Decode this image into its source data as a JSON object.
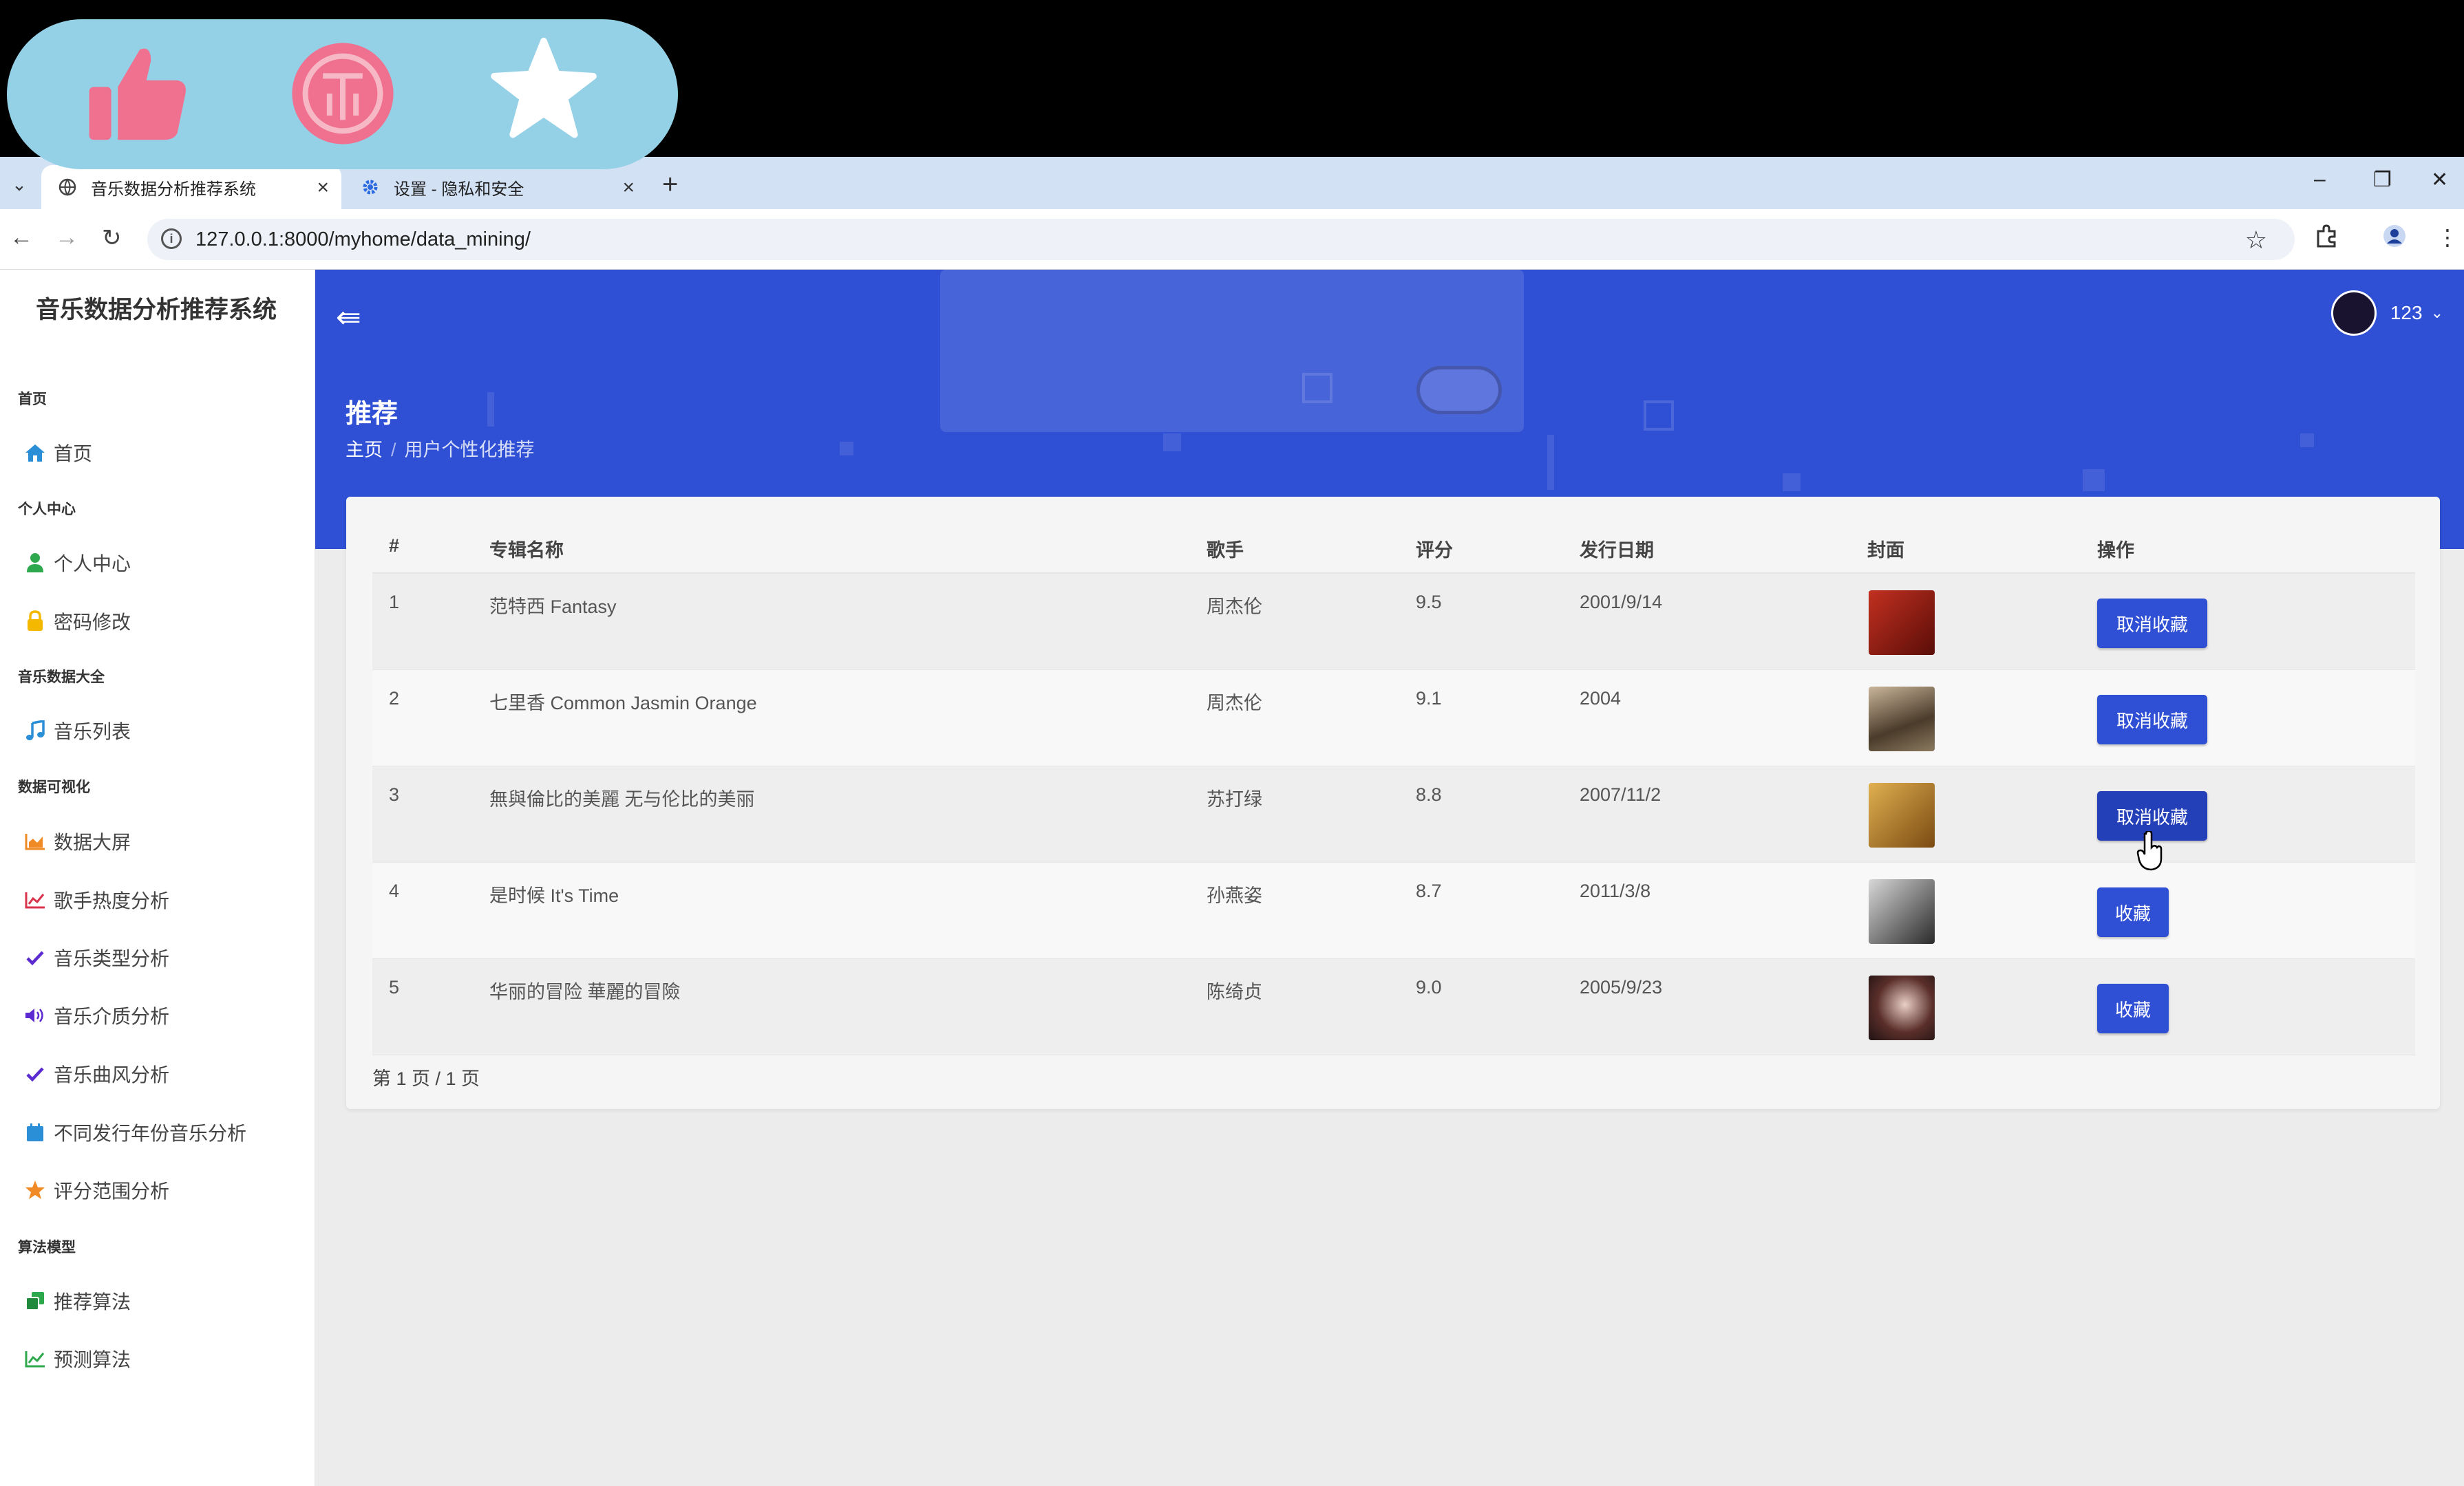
{
  "browser": {
    "tabs": [
      {
        "title": "音乐数据分析推荐系统",
        "close": "×"
      },
      {
        "title": "设置 - 隐私和安全",
        "close": "×"
      }
    ],
    "new_tab": "+",
    "window": {
      "minimize": "–",
      "restore": "❐",
      "close": "✕"
    },
    "url": "127.0.0.1:8000/myhome/data_mining/"
  },
  "sidebar": {
    "brand": "音乐数据分析推荐系统",
    "sections": [
      {
        "label": "首页",
        "items": [
          {
            "label": "首页",
            "icon": "home-icon"
          }
        ]
      },
      {
        "label": "个人中心",
        "items": [
          {
            "label": "个人中心",
            "icon": "user-icon"
          },
          {
            "label": "密码修改",
            "icon": "lock-icon"
          }
        ]
      },
      {
        "label": "音乐数据大全",
        "items": [
          {
            "label": "音乐列表",
            "icon": "music-icon"
          }
        ]
      },
      {
        "label": "数据可视化",
        "items": [
          {
            "label": "数据大屏",
            "icon": "area-chart-icon"
          },
          {
            "label": "歌手热度分析",
            "icon": "line-chart-icon"
          },
          {
            "label": "音乐类型分析",
            "icon": "check-icon"
          },
          {
            "label": "音乐介质分析",
            "icon": "volume-icon"
          },
          {
            "label": "音乐曲风分析",
            "icon": "check-icon"
          },
          {
            "label": "不同发行年份音乐分析",
            "icon": "calendar-icon"
          },
          {
            "label": "评分范围分析",
            "icon": "star-icon"
          }
        ]
      },
      {
        "label": "算法模型",
        "items": [
          {
            "label": "推荐算法",
            "icon": "clone-icon"
          },
          {
            "label": "预测算法",
            "icon": "line-chart-icon"
          }
        ]
      }
    ]
  },
  "header": {
    "user_name": "123",
    "title": "推荐",
    "breadcrumb": {
      "home": "主页",
      "sep": "/",
      "current": "用户个性化推荐"
    }
  },
  "table": {
    "headers": {
      "index": "#",
      "album": "专辑名称",
      "singer": "歌手",
      "score": "评分",
      "date": "发行日期",
      "cover": "封面",
      "action": "操作"
    },
    "rows": [
      {
        "index": "1",
        "album": "范特西 Fantasy",
        "singer": "周杰伦",
        "score": "9.5",
        "date": "2001/9/14",
        "action": "取消收藏",
        "cover_color": "#8a1b12"
      },
      {
        "index": "2",
        "album": "七里香 Common Jasmin Orange",
        "singer": "周杰伦",
        "score": "9.1",
        "date": "2004",
        "action": "取消收藏",
        "cover_color": "#6b5a44"
      },
      {
        "index": "3",
        "album": "無與倫比的美麗 无与伦比的美丽",
        "singer": "苏打绿",
        "score": "8.8",
        "date": "2007/11/2",
        "action": "取消收藏",
        "cover_color": "#b6892f"
      },
      {
        "index": "4",
        "album": "是时候 It's Time",
        "singer": "孙燕姿",
        "score": "8.7",
        "date": "2011/3/8",
        "action": "收藏",
        "cover_color": "#3a3a3a"
      },
      {
        "index": "5",
        "album": "华丽的冒险 華麗的冒險",
        "singer": "陈绮贞",
        "score": "9.0",
        "date": "2005/9/23",
        "action": "收藏",
        "cover_color": "#4a2d2a"
      }
    ],
    "pager": "第 1 页 / 1 页"
  },
  "colors": {
    "primary": "#2f4fd4",
    "overlay": "#95d1e6",
    "thumb": "#f0708f"
  }
}
